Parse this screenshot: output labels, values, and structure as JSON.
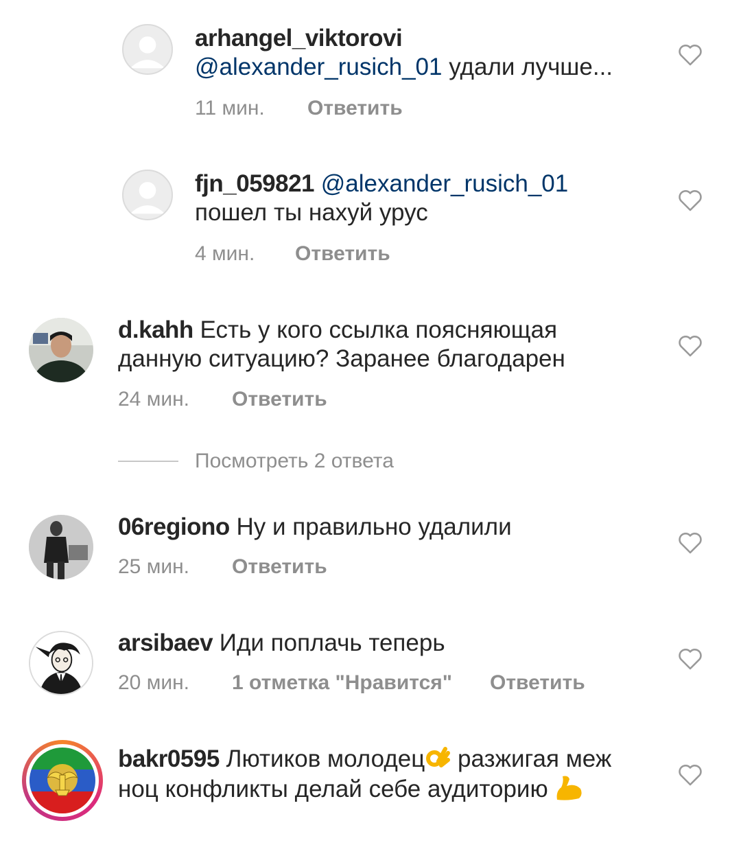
{
  "comments": [
    {
      "username": "arhangel_viktorovi",
      "mention": "@alexander_rusich_01",
      "text": "удали лучше...",
      "time": "11 мин.",
      "reply_label": "Ответить",
      "avatar": "default-avatar-icon"
    },
    {
      "username": "fjn_059821",
      "mention": "@alexander_rusich_01",
      "text": "пошел ты нахуй урус",
      "time": "4 мин.",
      "reply_label": "Ответить",
      "avatar": "default-avatar-icon"
    },
    {
      "username": "d.kahh",
      "text": "Есть у кого ссылка поясняющая данную ситуацию? Заранее благодарен",
      "time": "24 мин.",
      "reply_label": "Ответить",
      "avatar": "user-photo-avatar"
    },
    {
      "username": "06regiono",
      "text": "Ну и правильно удалили",
      "time": "25 мин.",
      "reply_label": "Ответить",
      "avatar": "user-photo-avatar"
    },
    {
      "username": "arsibaev",
      "text": "Иди поплачь теперь",
      "time": "20 мин.",
      "likes": "1 отметка \"Нравится\"",
      "reply_label": "Ответить",
      "avatar": "cartoon-avatar"
    },
    {
      "username": "bakr0595",
      "text_1": "Лютиков молодец",
      "text_2": "разжигая меж ноц конфликты делай себе аудиторию",
      "emoji_1": "ok-hand-emoji",
      "emoji_2": "flexed-biceps-emoji",
      "avatar": "dagestan-emblem-avatar"
    }
  ],
  "view_replies": "Посмотреть 2 ответа",
  "icons": {
    "like": "heart-outline-icon"
  },
  "colors": {
    "mention": "#003569",
    "meta": "#8e8e8e",
    "text": "#262626"
  }
}
